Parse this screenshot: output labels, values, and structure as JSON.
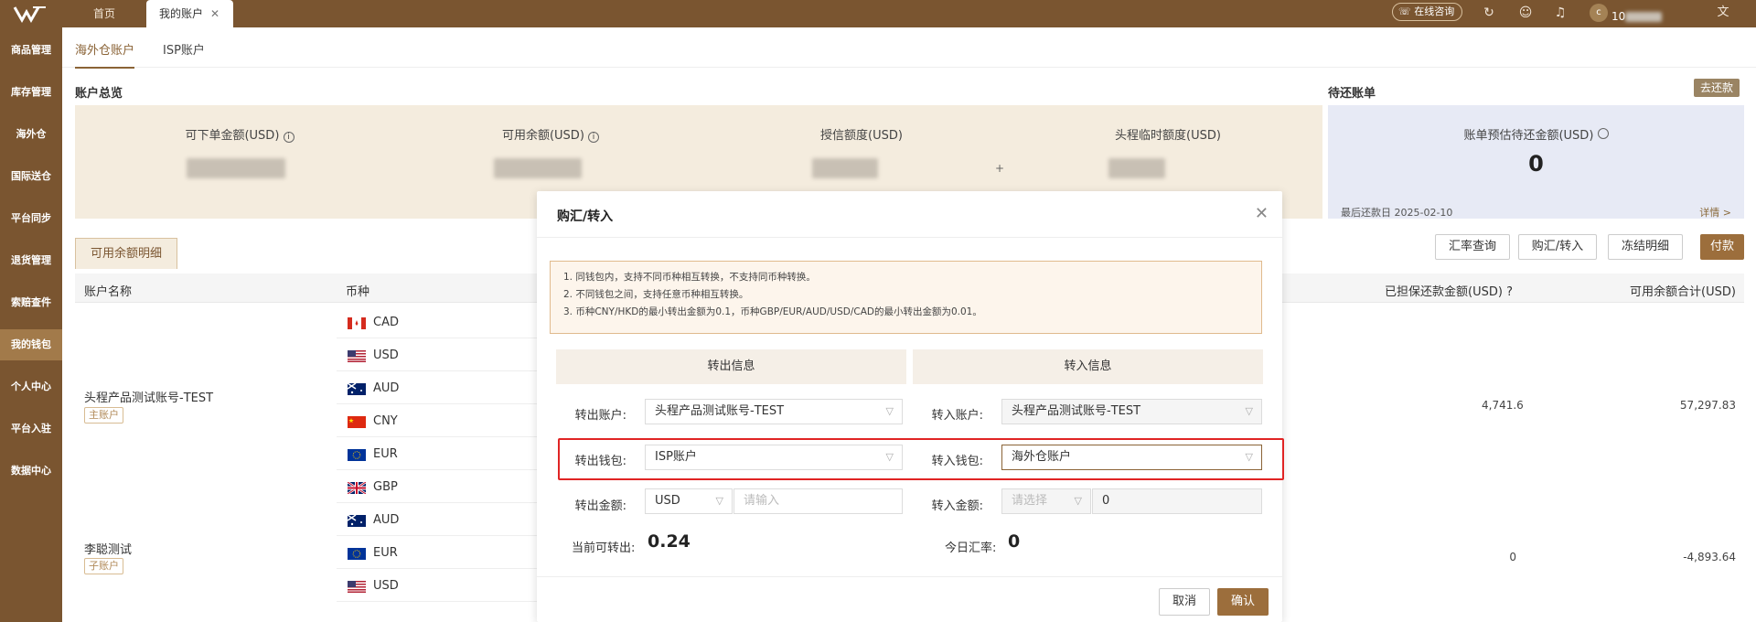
{
  "topbar": {
    "tabs": [
      {
        "label": "首页"
      },
      {
        "label": "我的账户"
      }
    ],
    "close_glyph": "✕",
    "consult_label": "在线咨询",
    "avatar_letter": "c",
    "user_id_prefix": "10",
    "icons": [
      "logo-icon",
      "refresh-icon",
      "smile-icon",
      "bell-icon",
      "translate-icon"
    ]
  },
  "sidebar": {
    "items": [
      {
        "label": "商品管理"
      },
      {
        "label": "库存管理"
      },
      {
        "label": "海外仓"
      },
      {
        "label": "国际送仓"
      },
      {
        "label": "平台同步"
      },
      {
        "label": "退货管理"
      },
      {
        "label": "索赔查件"
      },
      {
        "label": "我的钱包",
        "active": true
      },
      {
        "label": "个人中心"
      },
      {
        "label": "平台入驻"
      },
      {
        "label": "数据中心"
      }
    ]
  },
  "subtabs": [
    {
      "label": "海外仓账户"
    },
    {
      "label": "ISP账户"
    }
  ],
  "overview": {
    "title": "账户总览",
    "columns": [
      {
        "label": "可下单金额(USD)",
        "info": "i"
      },
      {
        "label": "可用余额(USD)",
        "info": "i"
      },
      {
        "label": "授信额度(USD)"
      },
      {
        "label": "头程临时额度(USD)"
      }
    ],
    "plus_sign": "+"
  },
  "pending": {
    "title": "待还账单",
    "repay_button": "去还款",
    "est_label": "账单预估待还金额(USD)",
    "est_value": "0",
    "last_date_label": "最后还款日 2025-02-10",
    "detail_link": "详情 >"
  },
  "actions": [
    {
      "label": "汇率查询"
    },
    {
      "label": "购汇/转入"
    },
    {
      "label": "冻结明细"
    },
    {
      "label": "付款"
    }
  ],
  "detail_tab": "可用余额明细",
  "table": {
    "headers": {
      "account": "账户名称",
      "currency": "币种",
      "guaranteed": "已担保还款金额(USD)",
      "total": "可用余额合计(USD)"
    },
    "rows": [
      {
        "currency": "CAD",
        "flag": "ca"
      },
      {
        "currency": "USD",
        "flag": "us"
      },
      {
        "currency": "AUD",
        "flag": "au"
      },
      {
        "currency": "CNY",
        "flag": "cn"
      },
      {
        "currency": "EUR",
        "flag": "eu"
      },
      {
        "currency": "GBP",
        "flag": "gb"
      },
      {
        "currency": "AUD",
        "flag": "au"
      },
      {
        "currency": "EUR",
        "flag": "eu"
      },
      {
        "currency": "USD",
        "flag": "us"
      }
    ],
    "accounts": [
      {
        "name": "头程产品测试账号-TEST",
        "badge": "主账户",
        "guaranteed": "4,741.6",
        "total": "57,297.83"
      },
      {
        "name": "李聪测试",
        "badge": "子账户",
        "guaranteed": "0",
        "total": "-4,893.64"
      }
    ]
  },
  "modal": {
    "title": "购汇/转入",
    "close_glyph": "✕",
    "notice": [
      "1. 同钱包内，支持不同币种相互转换，不支持同币种转换。",
      "2. 不同钱包之间，支持任意币种相互转换。",
      "3. 币种CNY/HKD的最小转出金额为0.1，币种GBP/EUR/AUD/USD/CAD的最小转出金额为0.01。"
    ],
    "out_header": "转出信息",
    "in_header": "转入信息",
    "out_account_label": "转出账户:",
    "out_account_value": "头程产品测试账号-TEST",
    "in_account_label": "转入账户:",
    "in_account_value": "头程产品测试账号-TEST",
    "out_wallet_label": "转出钱包:",
    "out_wallet_value": "ISP账户",
    "in_wallet_label": "转入钱包:",
    "in_wallet_value": "海外仓账户",
    "out_amount_label": "转出金额:",
    "out_currency_value": "USD",
    "out_amount_placeholder": "请输入",
    "in_amount_label": "转入金额:",
    "in_currency_placeholder": "请选择",
    "in_amount_value": "0",
    "available_label": "当前可转出:",
    "available_value": "0.24",
    "rate_label": "今日汇率:",
    "rate_value": "0",
    "cancel_label": "取消",
    "confirm_label": "确认"
  },
  "colors": {
    "brand": "#7a5530",
    "accent": "#9c6e3c",
    "highlight": "#e02424"
  }
}
